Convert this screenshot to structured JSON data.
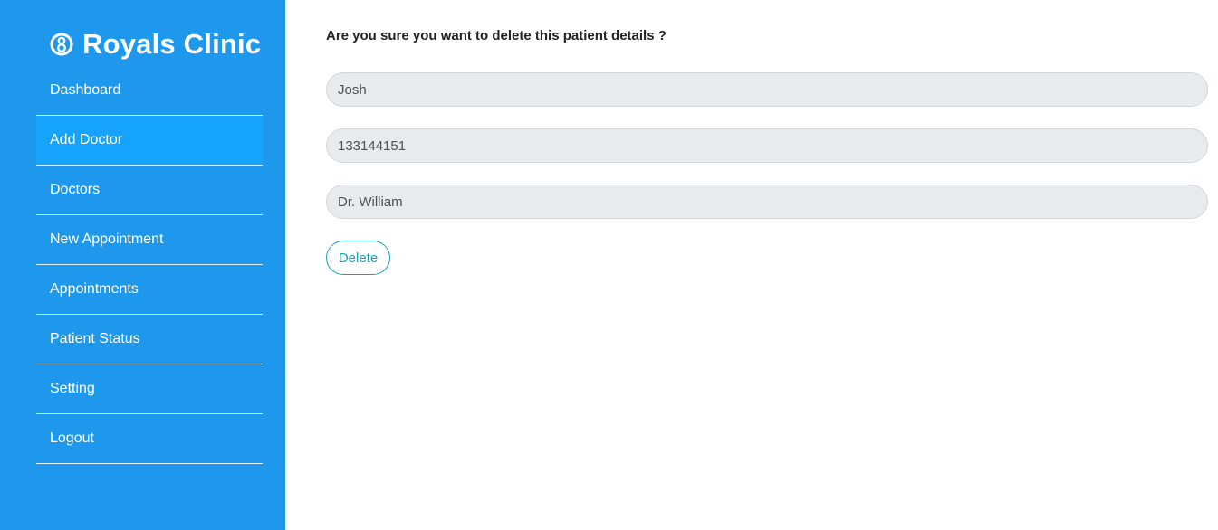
{
  "brand": {
    "title": "Royals Clinic",
    "icon": "clinic-logo-icon"
  },
  "sidebar": {
    "items": [
      {
        "label": "Dashboard"
      },
      {
        "label": "Add Doctor",
        "active": true
      },
      {
        "label": "Doctors"
      },
      {
        "label": "New Appointment"
      },
      {
        "label": "Appointments"
      },
      {
        "label": "Patient Status"
      },
      {
        "label": "Setting"
      },
      {
        "label": "Logout"
      }
    ]
  },
  "main": {
    "question": "Are you sure you want to delete this patient details ?",
    "fields": {
      "patient_name": "Josh",
      "patient_phone": "133144151",
      "doctor_name": "Dr. William"
    },
    "delete_label": "Delete"
  },
  "colors": {
    "sidebar": "#1e98ec",
    "active_item": "#16a3ff",
    "accent": "#17a2b8",
    "field_bg": "#e8ebee"
  }
}
